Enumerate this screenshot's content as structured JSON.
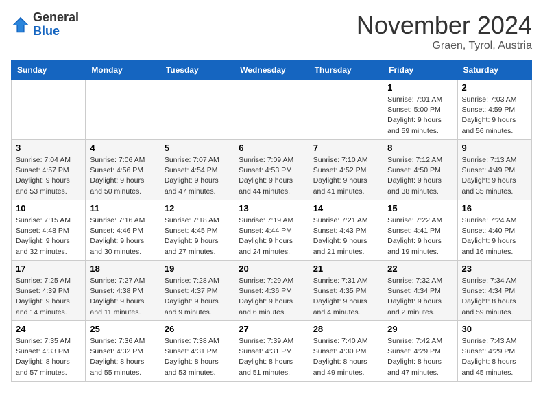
{
  "header": {
    "logo": {
      "general": "General",
      "blue": "Blue",
      "tagline": ""
    },
    "title": "November 2024",
    "location": "Graen, Tyrol, Austria"
  },
  "calendar": {
    "days_of_week": [
      "Sunday",
      "Monday",
      "Tuesday",
      "Wednesday",
      "Thursday",
      "Friday",
      "Saturday"
    ],
    "weeks": [
      {
        "row_style": "row-white",
        "days": [
          {
            "date": "",
            "info": ""
          },
          {
            "date": "",
            "info": ""
          },
          {
            "date": "",
            "info": ""
          },
          {
            "date": "",
            "info": ""
          },
          {
            "date": "",
            "info": ""
          },
          {
            "date": "1",
            "info": "Sunrise: 7:01 AM\nSunset: 5:00 PM\nDaylight: 9 hours\nand 59 minutes."
          },
          {
            "date": "2",
            "info": "Sunrise: 7:03 AM\nSunset: 4:59 PM\nDaylight: 9 hours\nand 56 minutes."
          }
        ]
      },
      {
        "row_style": "row-gray",
        "days": [
          {
            "date": "3",
            "info": "Sunrise: 7:04 AM\nSunset: 4:57 PM\nDaylight: 9 hours\nand 53 minutes."
          },
          {
            "date": "4",
            "info": "Sunrise: 7:06 AM\nSunset: 4:56 PM\nDaylight: 9 hours\nand 50 minutes."
          },
          {
            "date": "5",
            "info": "Sunrise: 7:07 AM\nSunset: 4:54 PM\nDaylight: 9 hours\nand 47 minutes."
          },
          {
            "date": "6",
            "info": "Sunrise: 7:09 AM\nSunset: 4:53 PM\nDaylight: 9 hours\nand 44 minutes."
          },
          {
            "date": "7",
            "info": "Sunrise: 7:10 AM\nSunset: 4:52 PM\nDaylight: 9 hours\nand 41 minutes."
          },
          {
            "date": "8",
            "info": "Sunrise: 7:12 AM\nSunset: 4:50 PM\nDaylight: 9 hours\nand 38 minutes."
          },
          {
            "date": "9",
            "info": "Sunrise: 7:13 AM\nSunset: 4:49 PM\nDaylight: 9 hours\nand 35 minutes."
          }
        ]
      },
      {
        "row_style": "row-white",
        "days": [
          {
            "date": "10",
            "info": "Sunrise: 7:15 AM\nSunset: 4:48 PM\nDaylight: 9 hours\nand 32 minutes."
          },
          {
            "date": "11",
            "info": "Sunrise: 7:16 AM\nSunset: 4:46 PM\nDaylight: 9 hours\nand 30 minutes."
          },
          {
            "date": "12",
            "info": "Sunrise: 7:18 AM\nSunset: 4:45 PM\nDaylight: 9 hours\nand 27 minutes."
          },
          {
            "date": "13",
            "info": "Sunrise: 7:19 AM\nSunset: 4:44 PM\nDaylight: 9 hours\nand 24 minutes."
          },
          {
            "date": "14",
            "info": "Sunrise: 7:21 AM\nSunset: 4:43 PM\nDaylight: 9 hours\nand 21 minutes."
          },
          {
            "date": "15",
            "info": "Sunrise: 7:22 AM\nSunset: 4:41 PM\nDaylight: 9 hours\nand 19 minutes."
          },
          {
            "date": "16",
            "info": "Sunrise: 7:24 AM\nSunset: 4:40 PM\nDaylight: 9 hours\nand 16 minutes."
          }
        ]
      },
      {
        "row_style": "row-gray",
        "days": [
          {
            "date": "17",
            "info": "Sunrise: 7:25 AM\nSunset: 4:39 PM\nDaylight: 9 hours\nand 14 minutes."
          },
          {
            "date": "18",
            "info": "Sunrise: 7:27 AM\nSunset: 4:38 PM\nDaylight: 9 hours\nand 11 minutes."
          },
          {
            "date": "19",
            "info": "Sunrise: 7:28 AM\nSunset: 4:37 PM\nDaylight: 9 hours\nand 9 minutes."
          },
          {
            "date": "20",
            "info": "Sunrise: 7:29 AM\nSunset: 4:36 PM\nDaylight: 9 hours\nand 6 minutes."
          },
          {
            "date": "21",
            "info": "Sunrise: 7:31 AM\nSunset: 4:35 PM\nDaylight: 9 hours\nand 4 minutes."
          },
          {
            "date": "22",
            "info": "Sunrise: 7:32 AM\nSunset: 4:34 PM\nDaylight: 9 hours\nand 2 minutes."
          },
          {
            "date": "23",
            "info": "Sunrise: 7:34 AM\nSunset: 4:34 PM\nDaylight: 8 hours\nand 59 minutes."
          }
        ]
      },
      {
        "row_style": "row-white",
        "days": [
          {
            "date": "24",
            "info": "Sunrise: 7:35 AM\nSunset: 4:33 PM\nDaylight: 8 hours\nand 57 minutes."
          },
          {
            "date": "25",
            "info": "Sunrise: 7:36 AM\nSunset: 4:32 PM\nDaylight: 8 hours\nand 55 minutes."
          },
          {
            "date": "26",
            "info": "Sunrise: 7:38 AM\nSunset: 4:31 PM\nDaylight: 8 hours\nand 53 minutes."
          },
          {
            "date": "27",
            "info": "Sunrise: 7:39 AM\nSunset: 4:31 PM\nDaylight: 8 hours\nand 51 minutes."
          },
          {
            "date": "28",
            "info": "Sunrise: 7:40 AM\nSunset: 4:30 PM\nDaylight: 8 hours\nand 49 minutes."
          },
          {
            "date": "29",
            "info": "Sunrise: 7:42 AM\nSunset: 4:29 PM\nDaylight: 8 hours\nand 47 minutes."
          },
          {
            "date": "30",
            "info": "Sunrise: 7:43 AM\nSunset: 4:29 PM\nDaylight: 8 hours\nand 45 minutes."
          }
        ]
      }
    ]
  }
}
